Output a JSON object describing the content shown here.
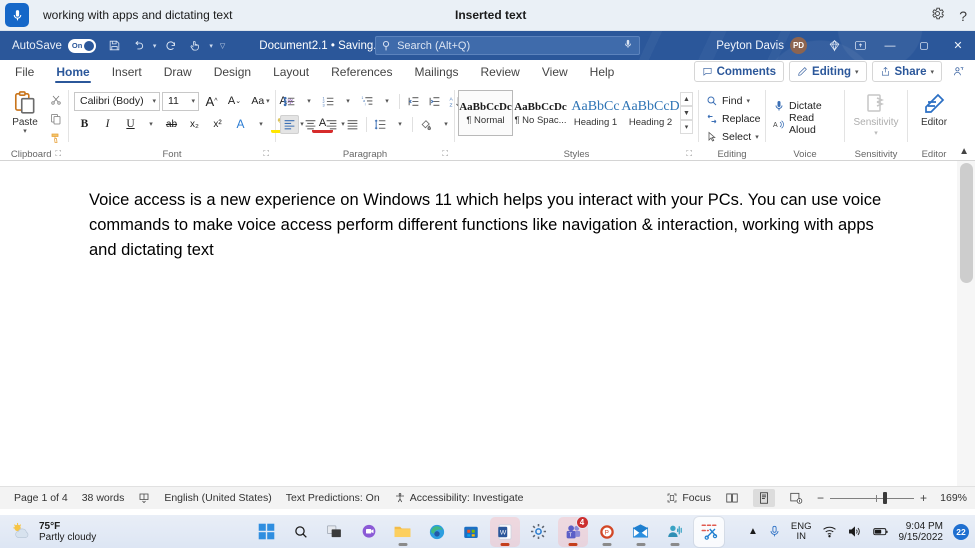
{
  "voice_access": {
    "mic_icon": "microphone-icon",
    "command_text": "working with apps and dictating text",
    "status_text": "Inserted text",
    "settings_icon": "gear-icon",
    "help_icon": "question-mark-icon"
  },
  "word": {
    "titlebar": {
      "autosave_label": "AutoSave",
      "autosave_state": "On",
      "quick_access": [
        {
          "name": "save-icon",
          "glyph": "⬒"
        },
        {
          "name": "undo-icon",
          "glyph": "↶"
        },
        {
          "name": "redo-icon",
          "glyph": "↻"
        },
        {
          "name": "touch-mode-icon",
          "glyph": "☝"
        },
        {
          "name": "customize-quick-access-icon",
          "glyph": "▽"
        }
      ],
      "document_name": "Document2.1 • Saving...",
      "search_placeholder": "Search (Alt+Q)",
      "search_icon": "search-icon",
      "search_mic_icon": "microphone-icon",
      "user_name": "Peyton Davis",
      "user_initials": "PD",
      "diamond_icon": "diamond-icon",
      "ribbon_display_icon": "ribbon-display-options-icon",
      "minimize": "—",
      "restore": "⬜",
      "close": "✕"
    },
    "tabs": [
      {
        "label": "File",
        "active": false
      },
      {
        "label": "Home",
        "active": true
      },
      {
        "label": "Insert",
        "active": false
      },
      {
        "label": "Draw",
        "active": false
      },
      {
        "label": "Design",
        "active": false
      },
      {
        "label": "Layout",
        "active": false
      },
      {
        "label": "References",
        "active": false
      },
      {
        "label": "Mailings",
        "active": false
      },
      {
        "label": "Review",
        "active": false
      },
      {
        "label": "View",
        "active": false
      },
      {
        "label": "Help",
        "active": false
      }
    ],
    "tabs_right": {
      "comments": "Comments",
      "editing": "Editing",
      "share": "Share",
      "share_user_icon": "share-person-icon"
    },
    "groups": {
      "clipboard": {
        "title": "Clipboard",
        "paste_label": "Paste",
        "cut_icon": "scissors-icon",
        "copy_icon": "copy-icon",
        "format_painter_icon": "format-painter-icon"
      },
      "font": {
        "title": "Font",
        "font_name": "Calibri (Body)",
        "font_size": "11",
        "grow_font": "A",
        "shrink_font": "A",
        "change_case": "Aa",
        "clear_formatting_icon": "clear-formatting-icon",
        "bold": "B",
        "italic": "I",
        "underline": "U",
        "strikethrough": "ab",
        "subscript": "x₂",
        "superscript": "x²",
        "text_effects": "A",
        "highlight": "A",
        "font_color": "A"
      },
      "paragraph": {
        "title": "Paragraph",
        "bullets_icon": "bullet-list-icon",
        "numbering_icon": "numbered-list-icon",
        "multilevel_icon": "multilevel-list-icon",
        "decrease_indent_icon": "decrease-indent-icon",
        "increase_indent_icon": "increase-indent-icon",
        "sort_icon": "sort-az-icon",
        "show_marks_icon": "paragraph-mark-icon",
        "align_left_icon": "align-left-icon",
        "align_center_icon": "align-center-icon",
        "align_right_icon": "align-right-icon",
        "justify_icon": "justify-icon",
        "line_spacing_icon": "line-spacing-icon",
        "shading_icon": "shading-icon",
        "borders_icon": "borders-icon"
      },
      "styles": {
        "title": "Styles",
        "items": [
          {
            "preview": "AaBbCcDc",
            "name": "¶ Normal",
            "selected": true,
            "blue": false
          },
          {
            "preview": "AaBbCcDc",
            "name": "¶ No Spac...",
            "selected": false,
            "blue": false
          },
          {
            "preview": "AaBbCc",
            "name": "Heading 1",
            "selected": false,
            "blue": true
          },
          {
            "preview": "AaBbCcD",
            "name": "Heading 2",
            "selected": false,
            "blue": true
          }
        ]
      },
      "editing": {
        "title": "Editing",
        "find": "Find",
        "replace": "Replace",
        "select": "Select",
        "find_icon": "search-icon",
        "replace_icon": "replace-icon",
        "select_icon": "cursor-select-icon"
      },
      "voice": {
        "title": "Voice",
        "dictate": "Dictate",
        "read_aloud": "Read Aloud",
        "dictate_icon": "microphone-icon",
        "read_aloud_icon": "read-aloud-icon"
      },
      "sensitivity": {
        "title": "Sensitivity",
        "label": "Sensitivity",
        "icon": "sensitivity-label-icon"
      },
      "editor": {
        "title": "Editor",
        "label": "Editor",
        "icon": "editor-pen-icon"
      },
      "collapse_icon": "chevron-up-icon"
    },
    "document": {
      "body_text": "Voice access is a new experience on Windows 11 which helps you interact with your PCs. You can use voice commands to make voice access perform different functions like navigation & interaction, working with apps and dictating text"
    },
    "statusbar": {
      "page": "Page 1 of 4",
      "words": "38 words",
      "proofing_icon": "proofing-errors-icon",
      "language": "English (United States)",
      "text_predictions": "Text Predictions: On",
      "accessibility": "Accessibility: Investigate",
      "accessibility_icon": "accessibility-icon",
      "focus": "Focus",
      "focus_icon": "focus-mode-icon",
      "read_mode_icon": "read-mode-icon",
      "print_layout_icon": "print-layout-icon",
      "web_layout_icon": "web-layout-icon",
      "zoom_out": "−",
      "zoom_in": "+",
      "zoom_level": "169%"
    }
  },
  "taskbar": {
    "weather": {
      "temperature": "75°F",
      "condition": "Partly cloudy",
      "icon": "partly-cloudy-icon"
    },
    "items": [
      {
        "name": "start-button",
        "icon": "windows-logo-icon"
      },
      {
        "name": "search-button",
        "icon": "search-icon"
      },
      {
        "name": "task-view-button",
        "icon": "task-view-icon"
      },
      {
        "name": "chat-button",
        "icon": "chat-icon"
      },
      {
        "name": "file-explorer-button",
        "icon": "folder-icon"
      },
      {
        "name": "edge-button",
        "icon": "edge-icon"
      },
      {
        "name": "microsoft-store-button",
        "icon": "store-icon"
      },
      {
        "name": "word-button",
        "icon": "word-icon"
      },
      {
        "name": "settings-button",
        "icon": "gear-icon"
      },
      {
        "name": "teams-button",
        "icon": "teams-icon",
        "badge": "4"
      },
      {
        "name": "powerpoint-button",
        "icon": "powerpoint-icon"
      },
      {
        "name": "mail-button",
        "icon": "mail-icon"
      },
      {
        "name": "voice-access-button",
        "icon": "voice-access-icon"
      },
      {
        "name": "snipping-tool-button",
        "icon": "snipping-tool-icon"
      }
    ],
    "tray": {
      "show_hidden_icon": "chevron-up-icon",
      "microphone_icon": "microphone-icon",
      "language_line1": "ENG",
      "language_line2": "IN",
      "network_icon": "wifi-icon",
      "volume_icon": "speaker-icon",
      "battery_icon": "battery-icon",
      "time": "9:04 PM",
      "date": "9/15/2022",
      "notification_count": "22"
    }
  }
}
